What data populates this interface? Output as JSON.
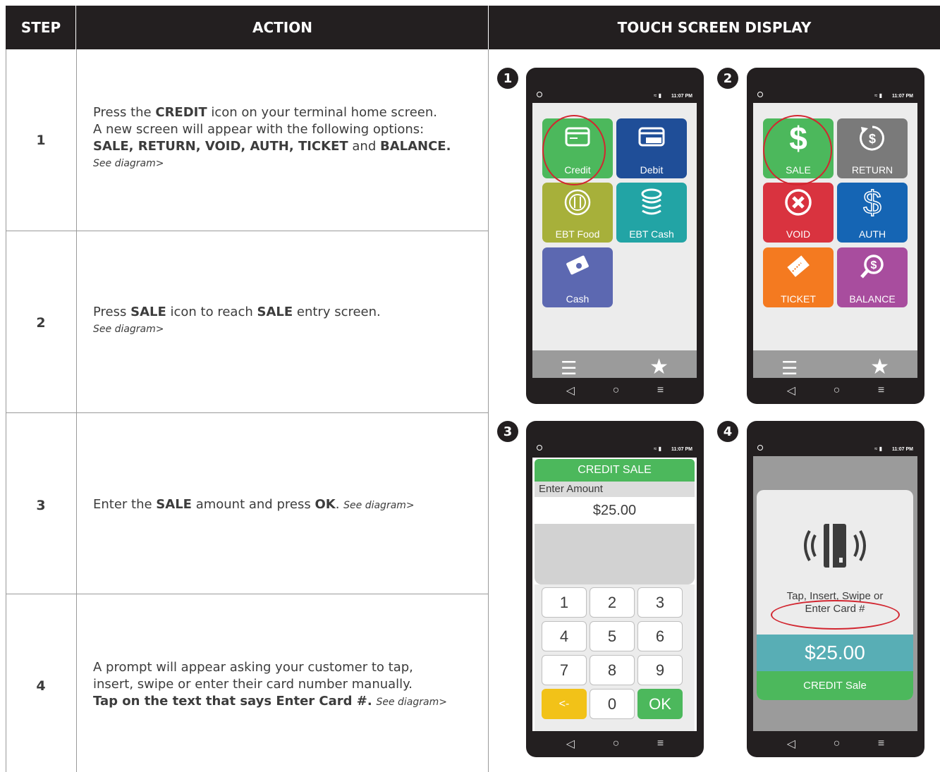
{
  "header": {
    "step": "STEP",
    "action": "ACTION",
    "display": "TOUCH SCREEN DISPLAY"
  },
  "steps": [
    {
      "num": "1"
    },
    {
      "num": "2"
    },
    {
      "num": "3"
    },
    {
      "num": "4"
    }
  ],
  "text": {
    "s1_a": "Press the ",
    "s1_b": "CREDIT",
    "s1_c": " icon on your terminal home screen.",
    "s1_d": "A new screen will appear with the following options:",
    "s1_e": "SALE, RETURN, VOID, AUTH, TICKET",
    "s1_f": " and ",
    "s1_g": "BALANCE.",
    "see": "See diagram>",
    "s2_a": "Press ",
    "s2_b": "SALE",
    "s2_c": " icon to reach ",
    "s2_d": "SALE",
    "s2_e": " entry screen.",
    "s3_a": "Enter the ",
    "s3_b": "SALE",
    "s3_c": " amount and press ",
    "s3_d": "OK",
    "s3_e": ". ",
    "s4_a": "A prompt will appear asking your customer to tap,",
    "s4_b": "insert, swipe or enter their card number manually.",
    "s4_c": "Tap on the text that says Enter Card #.",
    "s4_d": " "
  },
  "phone": {
    "time": "11:07 PM",
    "badges": [
      "1",
      "2",
      "3",
      "4"
    ]
  },
  "screen1": {
    "tiles": [
      {
        "label": "Credit",
        "color": "#4cb85c"
      },
      {
        "label": "Debit",
        "color": "#1f4e98"
      },
      {
        "label": "EBT Food",
        "color": "#a7b03a"
      },
      {
        "label": "EBT Cash",
        "color": "#22a4a5"
      },
      {
        "label": "Cash",
        "color": "#5c68b1"
      }
    ],
    "debit_card_text": "DEBIT"
  },
  "screen2": {
    "tiles": [
      {
        "label": "SALE",
        "color": "#4cb85c"
      },
      {
        "label": "RETURN",
        "color": "#7a7a7a"
      },
      {
        "label": "VOID",
        "color": "#d9333f"
      },
      {
        "label": "AUTH",
        "color": "#1565b4"
      },
      {
        "label": "TICKET",
        "color": "#f47a20"
      },
      {
        "label": "BALANCE",
        "color": "#a84d9e"
      }
    ]
  },
  "screen3": {
    "title": "CREDIT SALE",
    "prompt": "Enter Amount",
    "amount": "$25.00",
    "keys": [
      "1",
      "2",
      "3",
      "4",
      "5",
      "6",
      "7",
      "8",
      "9",
      "<-",
      "0",
      "OK"
    ]
  },
  "screen4": {
    "prompt_line1": "Tap, Insert, Swipe or",
    "prompt_line2": "Enter Card #",
    "amount": "$25.00",
    "footer": "CREDIT Sale"
  }
}
